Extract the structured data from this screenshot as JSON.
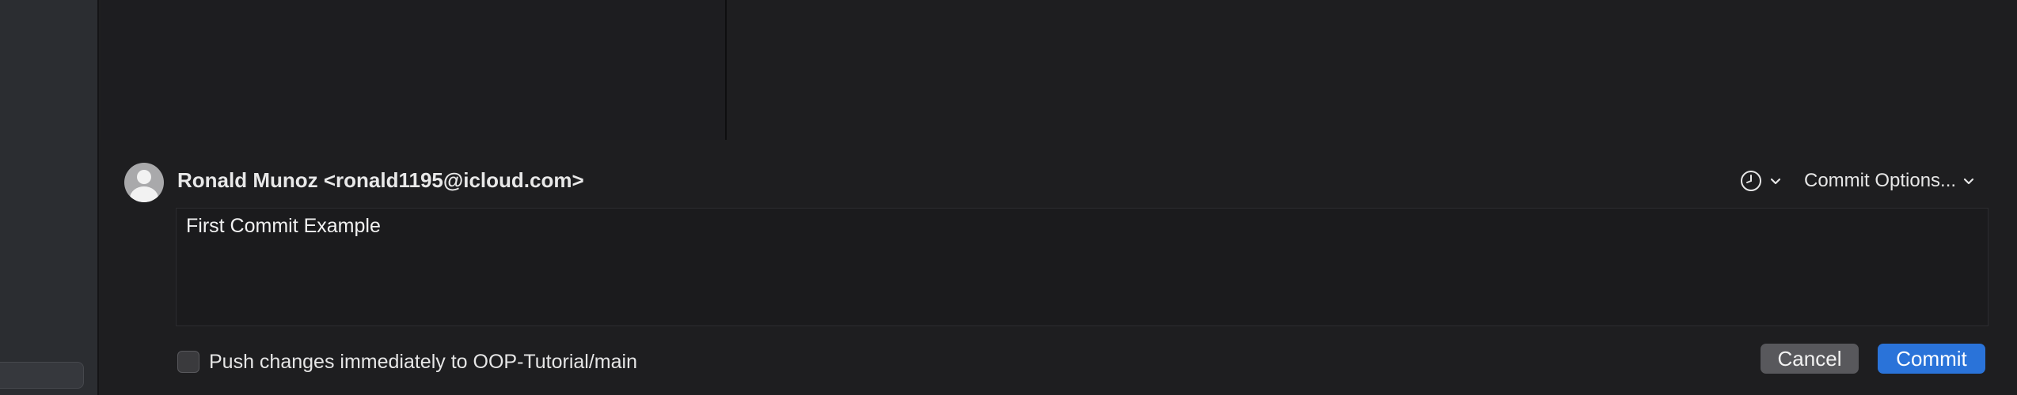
{
  "commit": {
    "author": "Ronald Munoz <ronald1195@icloud.com>",
    "message": "First Commit Example",
    "options_label": "Commit Options...",
    "push_label": "Push changes immediately to OOP-Tutorial/main",
    "push_checked": false,
    "cancel_label": "Cancel",
    "commit_label": "Commit"
  },
  "icons": {
    "history": "clock-icon",
    "dropdown": "chevron-down-icon",
    "avatar": "person-icon"
  },
  "colors": {
    "accent": "#2a73d9",
    "background": "#1e1e20",
    "sidebar": "#2b2d31",
    "secondary_button": "#58585c"
  }
}
